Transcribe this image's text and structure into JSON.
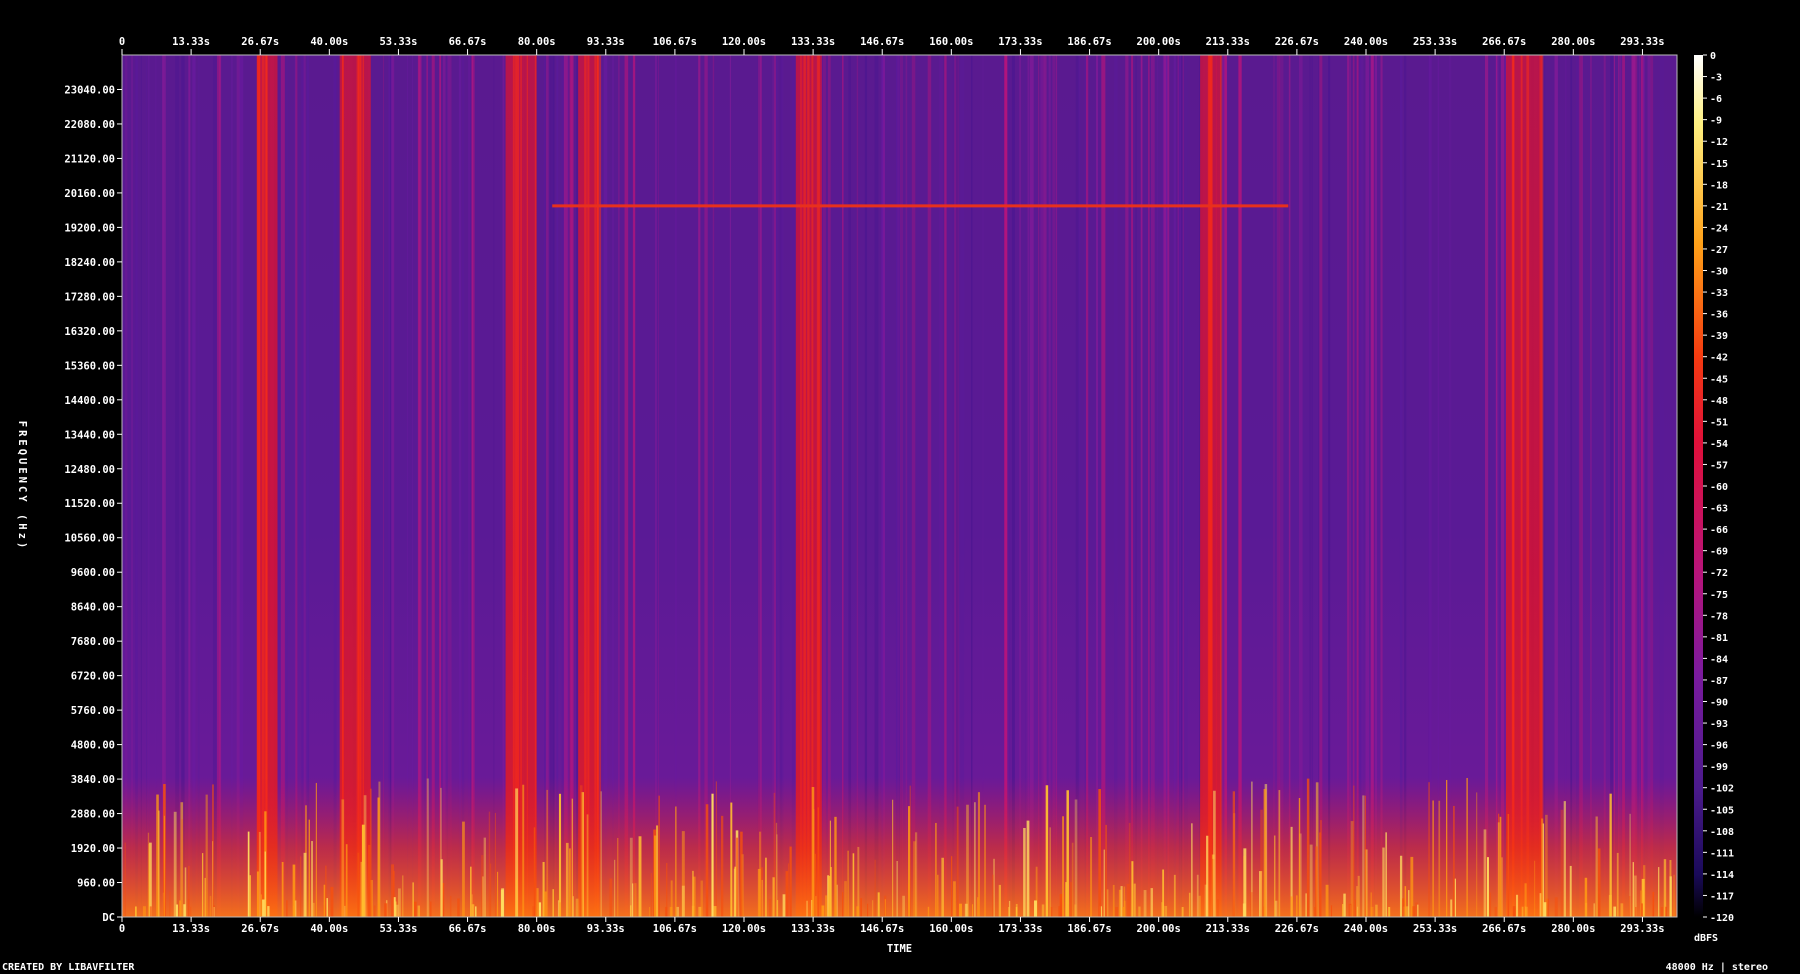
{
  "chart_data": {
    "type": "heatmap",
    "title": "",
    "xlabel": "TIME",
    "ylabel": "FREQUENCY (Hz)",
    "x_ticks": [
      "0",
      "13.33s",
      "26.67s",
      "40.00s",
      "53.33s",
      "66.67s",
      "80.00s",
      "93.33s",
      "106.67s",
      "120.00s",
      "133.33s",
      "146.67s",
      "160.00s",
      "173.33s",
      "186.67s",
      "200.00s",
      "213.33s",
      "226.67s",
      "240.00s",
      "253.33s",
      "266.67s",
      "280.00s",
      "293.33s"
    ],
    "y_ticks": [
      "DC",
      "960.00",
      "1920.00",
      "2880.00",
      "3840.00",
      "4800.00",
      "5760.00",
      "6720.00",
      "7680.00",
      "8640.00",
      "9600.00",
      "10560.00",
      "11520.00",
      "12480.00",
      "13440.00",
      "14400.00",
      "15360.00",
      "16320.00",
      "17280.00",
      "18240.00",
      "19200.00",
      "20160.00",
      "21120.00",
      "22080.00",
      "23040.00"
    ],
    "xlim": [
      0,
      300
    ],
    "ylim": [
      0,
      24000
    ],
    "colorbar": {
      "label": "dBFS",
      "ticks": [
        "0",
        "-3",
        "-6",
        "-9",
        "-12",
        "-15",
        "-18",
        "-21",
        "-24",
        "-27",
        "-30",
        "-33",
        "-36",
        "-39",
        "-42",
        "-45",
        "-48",
        "-51",
        "-54",
        "-57",
        "-60",
        "-63",
        "-66",
        "-69",
        "-72",
        "-75",
        "-78",
        "-81",
        "-84",
        "-87",
        "-90",
        "-93",
        "-96",
        "-99",
        "-102",
        "-105",
        "-108",
        "-111",
        "-114",
        "-117",
        "-120"
      ],
      "range": [
        -120,
        0
      ]
    },
    "colormap": [
      "#000000",
      "#1a0a5a",
      "#4b1a8c",
      "#7a1a9e",
      "#b8147a",
      "#e0103a",
      "#f53a10",
      "#ffa018",
      "#fff080",
      "#ffffff"
    ],
    "loud_segments_s": [
      [
        26,
        30
      ],
      [
        42,
        48
      ],
      [
        74,
        80
      ],
      [
        88,
        92
      ],
      [
        130,
        135
      ],
      [
        208,
        212
      ],
      [
        267,
        274
      ]
    ],
    "tone_line": {
      "freq_hz": 19800,
      "start_s": 83,
      "end_s": 225
    }
  },
  "footer": {
    "left": "CREATED BY LIBAVFILTER",
    "right": "48000 Hz | stereo"
  }
}
